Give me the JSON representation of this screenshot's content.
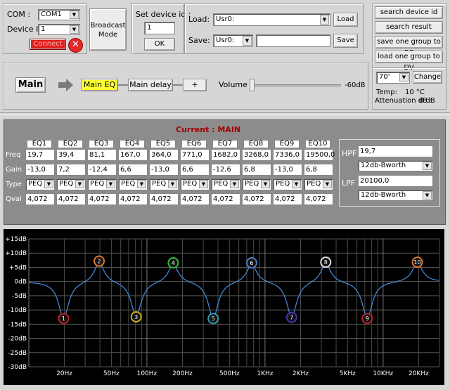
{
  "com": {
    "label": "COM :",
    "value": "COM1"
  },
  "device_id": {
    "label": "Device ID :",
    "value": "1"
  },
  "connect_label": "Connect",
  "broadcast": {
    "line1": "Broadcast",
    "line2": "Mode"
  },
  "set_device": {
    "label": "Set device id :",
    "value": "1",
    "ok": "OK"
  },
  "load": {
    "label": "Load:",
    "value": "Usr0:",
    "button": "Load"
  },
  "save": {
    "label": "Save:",
    "value": "Usr0:",
    "name": "",
    "button": "Save"
  },
  "right_buttons": [
    "search device id",
    "search result",
    "save one group to PC",
    "load one group to DV"
  ],
  "chain": {
    "main": "Main",
    "eq": "Main EQ",
    "delay": "Main delay",
    "plus": "+"
  },
  "volume": {
    "label": "Volume",
    "value": "-60dB",
    "level": 0
  },
  "temp": {
    "threshold": "70'",
    "change": "Change",
    "temp_label": "Temp:",
    "temp_value": "10 °C",
    "atten_label": "Attenuation dB :",
    "atten_value": "0 dB"
  },
  "current": {
    "label": "Current : MAIN"
  },
  "eq": {
    "row_labels": [
      "Freq",
      "Gain",
      "Type",
      "Qval"
    ],
    "bands": [
      {
        "name": "EQ1",
        "freq": "19,7",
        "gain": "-13,0",
        "type": "PEQ",
        "q": "4,072"
      },
      {
        "name": "EQ2",
        "freq": "39,4",
        "gain": "7,2",
        "type": "PEQ",
        "q": "4,072"
      },
      {
        "name": "EQ3",
        "freq": "81,1",
        "gain": "-12,4",
        "type": "PEQ",
        "q": "4,072"
      },
      {
        "name": "EQ4",
        "freq": "167,0",
        "gain": "6,6",
        "type": "PEQ",
        "q": "4,072"
      },
      {
        "name": "EQ5",
        "freq": "364,0",
        "gain": "-13,0",
        "type": "PEQ",
        "q": "4,072"
      },
      {
        "name": "EQ6",
        "freq": "771,0",
        "gain": "6,6",
        "type": "PEQ",
        "q": "4,072"
      },
      {
        "name": "EQ7",
        "freq": "1682,0",
        "gain": "-12,6",
        "type": "PEQ",
        "q": "4,072"
      },
      {
        "name": "EQ8",
        "freq": "3268,0",
        "gain": "6,8",
        "type": "PEQ",
        "q": "4,072"
      },
      {
        "name": "EQ9",
        "freq": "7336,0",
        "gain": "-13,0",
        "type": "PEQ",
        "q": "4,072"
      },
      {
        "name": "EQ10",
        "freq": "19500,0",
        "gain": "6,8",
        "type": "PEQ",
        "q": "4,072"
      }
    ],
    "hpf": {
      "label": "HPF",
      "freq": "19,7",
      "slope": "12db-Bworth"
    },
    "lpf": {
      "label": "LPF",
      "freq": "20100,0",
      "slope": "12db-Bworth"
    }
  },
  "chart_data": {
    "type": "line",
    "x_scale": "log",
    "xlim": [
      10,
      30000
    ],
    "ylim": [
      -30,
      15
    ],
    "y_ticks": [
      "+15dB",
      "+10dB",
      "+5dB",
      "0dB",
      "-5dB",
      "-10dB",
      "-15dB",
      "-20dB",
      "-25dB",
      "-30dB"
    ],
    "x_ticks": [
      {
        "label": "20Hz",
        "value": 20
      },
      {
        "label": "50Hz",
        "value": 50
      },
      {
        "label": "100Hz",
        "value": 100
      },
      {
        "label": "200Hz",
        "value": 200
      },
      {
        "label": "500Hz",
        "value": 500
      },
      {
        "label": "1KHz",
        "value": 1000
      },
      {
        "label": "2KHz",
        "value": 2000
      },
      {
        "label": "5KHz",
        "value": 5000
      },
      {
        "label": "10KHz",
        "value": 10000
      },
      {
        "label": "20KHz",
        "value": 20000
      }
    ],
    "grid": true,
    "points": [
      {
        "label": "1",
        "freq": 19.7,
        "gain": -13.0,
        "color": "#c0202a"
      },
      {
        "label": "2",
        "freq": 39.4,
        "gain": 7.2,
        "color": "#e0782a"
      },
      {
        "label": "3",
        "freq": 81.1,
        "gain": -12.4,
        "color": "#c8b020"
      },
      {
        "label": "4",
        "freq": 167.0,
        "gain": 6.6,
        "color": "#30c030"
      },
      {
        "label": "5",
        "freq": 364.0,
        "gain": -13.0,
        "color": "#30a0b0"
      },
      {
        "label": "6",
        "freq": 771.0,
        "gain": 6.6,
        "color": "#5080c0"
      },
      {
        "label": "7",
        "freq": 1682.0,
        "gain": -12.6,
        "color": "#5030b0"
      },
      {
        "label": "8",
        "freq": 3268.0,
        "gain": 6.8,
        "color": "#e0e0e0"
      },
      {
        "label": "9",
        "freq": 7336.0,
        "gain": -13.0,
        "color": "#c02030"
      },
      {
        "label": "10",
        "freq": 19500.0,
        "gain": 6.8,
        "color": "#e0782a"
      }
    ],
    "line_color": "#4a90e0"
  }
}
